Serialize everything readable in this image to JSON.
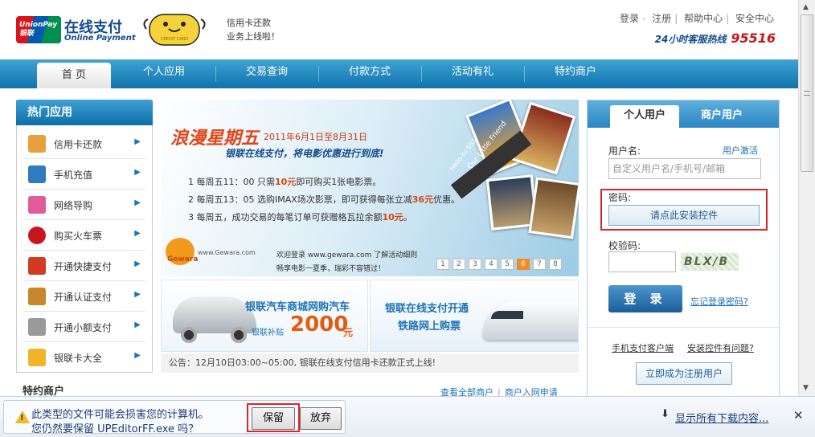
{
  "header": {
    "logo_en": "UnionPay 银联",
    "logo_cn": "在线支付",
    "logo_sub": "Online Payment",
    "mascot_label": "CREDIT CARD",
    "promo_line1": "信用卡还款",
    "promo_line2": "业务上线啦！",
    "links": [
      "登录",
      "注册",
      "帮助中心",
      "安全中心"
    ],
    "hotline_label": "24小时客服热线",
    "hotline_number": "95516"
  },
  "nav": {
    "items": [
      "首 页",
      "个人应用",
      "交易查询",
      "付款方式",
      "活动有礼",
      "特约商户"
    ],
    "active_index": 0
  },
  "sidebar": {
    "title": "热门应用",
    "items": [
      {
        "label": "信用卡还款",
        "icon": "credit-card-icon",
        "color": "#e8a13a"
      },
      {
        "label": "手机充值",
        "icon": "mobile-phone-icon",
        "color": "#2f7bc0"
      },
      {
        "label": "网络导购",
        "icon": "shopping-icon",
        "color": "#e35b9b"
      },
      {
        "label": "购买火车票",
        "icon": "train-icon",
        "color": "#c8161d"
      },
      {
        "label": "开通快捷支付",
        "icon": "quick-pay-icon",
        "color": "#d33a1f"
      },
      {
        "label": "开通认证支付",
        "icon": "certified-pay-icon",
        "color": "#c9862d"
      },
      {
        "label": "开通小额支付",
        "icon": "micro-pay-icon",
        "color": "#9a9a9a"
      },
      {
        "label": "银联卡大全",
        "icon": "card-collection-icon",
        "color": "#f0b429"
      }
    ]
  },
  "banner": {
    "title": "浪漫星期五",
    "date": "2011年6月1日至8月31日",
    "subtitle": "银联在线支付，将电影优惠进行到底!",
    "lines": [
      {
        "pre": "1 每周五11：00 只需",
        "hl": "10元",
        "post": "即可购买1张电影票。"
      },
      {
        "pre": "2 每周五13：05 选购IMAX场次影票，即可获得每张立减",
        "hl": "36元",
        "post": "优惠。"
      },
      {
        "pre": "3 每周五，成功交易的每笔订单可获赠格瓦拉余额",
        "hl": "10元",
        "post": "。"
      }
    ],
    "gewara_logo": "Gewara",
    "gewara_site": "www.Gewara.com",
    "footer_line1": "欢迎登录 www.gewara.com 了解活动细则",
    "footer_line2": "畅享电影一夏季，瑞彩不容错过！",
    "pages": [
      "1",
      "2",
      "3",
      "4",
      "5",
      "6",
      "7",
      "8"
    ],
    "current_page": "6",
    "photo_caption1": "Our Little Friend",
    "photo_caption2": "Hello to SSS"
  },
  "ads": {
    "car_title": "银联汽车商城网购汽车",
    "car_sub": "银联补贴",
    "car_amount": "2000",
    "car_unit": "元",
    "rail_line1": "银联在线支付开通",
    "rail_line2": "铁路网上购票"
  },
  "notice": "公告：12月10日03:00~05:00, 银联在线支付信用卡还款正式上线!",
  "featured": {
    "title": "特约商户",
    "link_all": "查看全部商户",
    "link_join": "商户入网申请"
  },
  "login": {
    "tab_personal": "个人用户",
    "tab_merchant": "商户用户",
    "username_label": "用户名:",
    "activate_link": "用户激活",
    "username_placeholder": "自定义用户名/手机号/邮箱",
    "password_label": "密码:",
    "install_control": "请点此安装控件",
    "captcha_label": "校验码:",
    "captcha_text": "BLX/B",
    "login_button": "登 录",
    "forgot_link": "忘记登录密码?",
    "mobile_client_link": "手机支付客户端",
    "control_help_link": "安装控件有问题?",
    "register_button": "立即成为注册用户"
  },
  "download_bar": {
    "warning_line1": "此类型的文件可能会损害您的计算机。",
    "warning_line2": "您仍然要保留 UPEditorFF.exe 吗？",
    "keep_button": "保留",
    "discard_button": "放弃",
    "show_all": "显示所有下载内容..."
  }
}
